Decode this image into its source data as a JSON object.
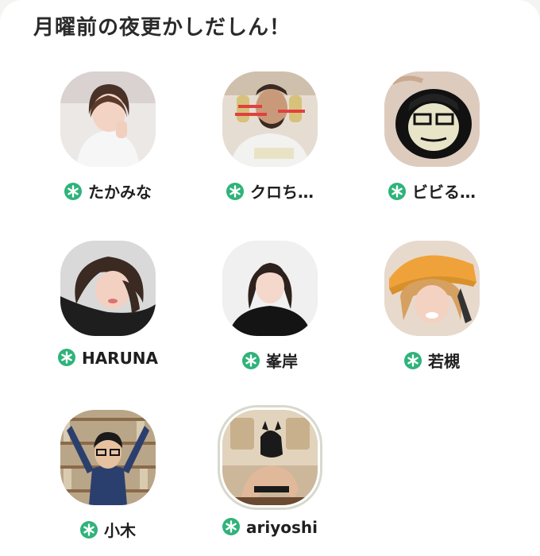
{
  "header": {
    "title": "月曜前の夜更かしだしん！"
  },
  "people": [
    {
      "name": "たかみな",
      "avatar_icon": "photo-woman-white-hoodie"
    },
    {
      "name": "クロち…",
      "avatar_icon": "photo-man-ice-cream"
    },
    {
      "name": "ビビる…",
      "avatar_icon": "photo-nail-art-face"
    },
    {
      "name": "HARUNA",
      "avatar_icon": "photo-woman-lying"
    },
    {
      "name": "峯岸",
      "avatar_icon": "photo-woman-dark-hair"
    },
    {
      "name": "若槻",
      "avatar_icon": "photo-woman-orange-hat"
    },
    {
      "name": "小木",
      "avatar_icon": "photo-man-glasses-arms-up"
    },
    {
      "name": "ariyoshi",
      "avatar_icon": "photo-man-dog-mask"
    }
  ],
  "colors": {
    "badge": "#2fb37a",
    "title_text": "#2a2a2a",
    "ring": "#d7d9cf"
  }
}
